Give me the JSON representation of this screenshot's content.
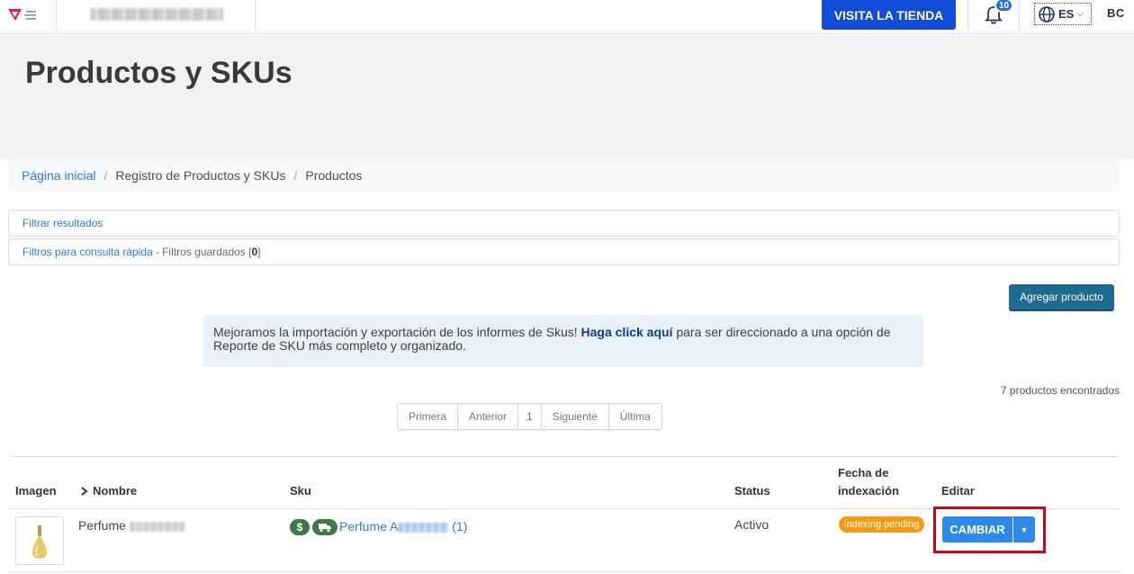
{
  "topbar": {
    "visit_store_label": "VISITA LA TIENDA",
    "notification_count": "10",
    "language": "ES",
    "user_initials": "BC"
  },
  "page": {
    "title": "Productos y SKUs"
  },
  "breadcrumb": {
    "items": [
      "Página inicial",
      "Registro de Productos y SKUs",
      "Productos"
    ]
  },
  "filters": {
    "filter_results": "Filtrar resultados",
    "quick_filters": "Filtros para consulta rápida -",
    "saved_filters_label": "Filtros guardados [",
    "saved_filters_count": "0",
    "saved_filters_close": "]"
  },
  "actions": {
    "add_product": "Agregar producto"
  },
  "notice": {
    "text_before": "Mejoramos la importación y exportación de los informes de Skus! ",
    "link": "Haga click aquí",
    "text_after": " para ser direccionado a una opción de Reporte de SKU más completo y organizado."
  },
  "results": {
    "found": "7 productos encontrados"
  },
  "pagination": [
    "Primera",
    "Anterior",
    "1",
    "Siguiente",
    "Última"
  ],
  "table": {
    "headers": {
      "image": "Imagen",
      "name": "Nombre",
      "sku": "Sku",
      "status": "Status",
      "index_date_line1": "Fecha de",
      "index_date_line2": "indexación",
      "edit": "Editar"
    },
    "rows": [
      {
        "name": "Perfume",
        "price_icon": "$",
        "sku_name_prefix": "Perfume A",
        "sku_count": "(1)",
        "status": "Activo",
        "index_status": "indexing pending",
        "edit_label": "CAMBIAR"
      }
    ]
  },
  "colors": {
    "primary_blue": "#134cd8",
    "link_blue": "#2c7bd5",
    "add_button": "#1d6b8f",
    "indexing_badge": "#f39c12",
    "highlight_border": "#d0021b",
    "sku_pill": "#3d7a44"
  }
}
